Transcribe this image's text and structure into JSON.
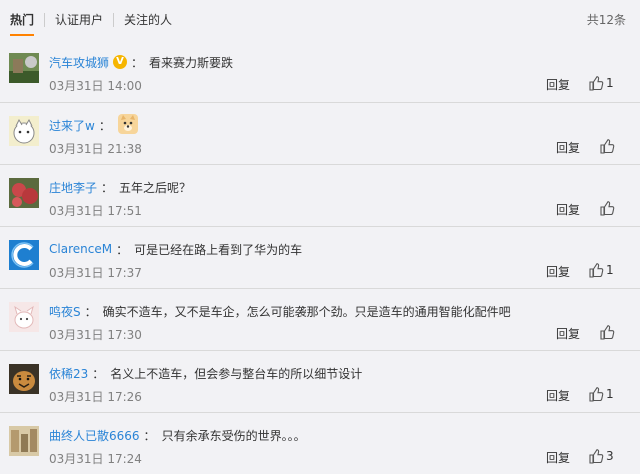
{
  "tabs": [
    {
      "label": "热门"
    },
    {
      "label": "认证用户"
    },
    {
      "label": "关注的人"
    }
  ],
  "total": "共12条",
  "reply_label": "回复",
  "comments": [
    {
      "user": "汽车攻城狮",
      "verified": true,
      "text": "看来赛力斯要跌",
      "time": "03月31日 14:00",
      "likes": "1"
    },
    {
      "user": "过来了w",
      "verified": false,
      "text": "",
      "emoji": "doge",
      "time": "03月31日 21:38",
      "likes": ""
    },
    {
      "user": "庄地李子",
      "verified": false,
      "text": "五年之后呢？",
      "time": "03月31日 17:51",
      "likes": ""
    },
    {
      "user": "ClarenceM",
      "verified": false,
      "text": "可是已经在路上看到了华为的车",
      "time": "03月31日 17:37",
      "likes": "1"
    },
    {
      "user": "鸣夜S",
      "verified": false,
      "text": "确实不造车，又不是车企，怎么可能袭那个劲。只是造车的通用智能化配件吧",
      "time": "03月31日 17:30",
      "likes": ""
    },
    {
      "user": "依稀23",
      "verified": false,
      "text": "名义上不造车，但会参与整台车的所以细节设计",
      "time": "03月31日 17:26",
      "likes": "1"
    },
    {
      "user": "曲终人已散6666",
      "verified": false,
      "text": "只有余承东受伤的世界。。。",
      "time": "03月31日 17:24",
      "likes": "3"
    }
  ],
  "colors": {
    "link": "#2a84d6",
    "accent": "#ff8200",
    "verified": "#f6b500"
  }
}
